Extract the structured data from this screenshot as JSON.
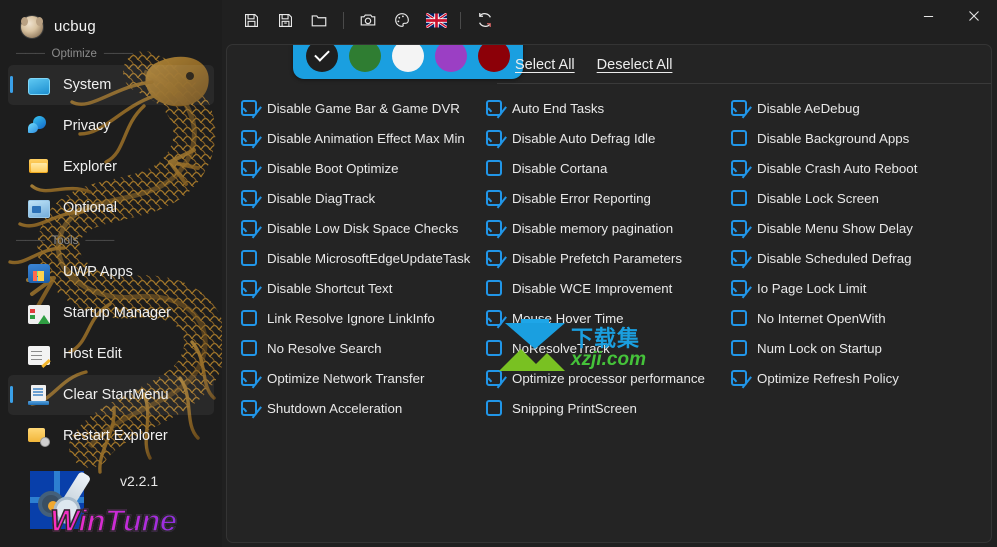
{
  "window": {
    "brand_name": "ucbug",
    "avatar_icon": "dog-avatar-icon",
    "minimize_label": "–",
    "close_label": "✕"
  },
  "toolbar": {
    "buttons": [
      {
        "name": "save-icon",
        "label": "Save"
      },
      {
        "name": "save-as-icon",
        "label": "Save As"
      },
      {
        "name": "open-folder-icon",
        "label": "Open"
      },
      {
        "name": "camera-icon",
        "label": "Screenshot"
      },
      {
        "name": "palette-icon",
        "label": "Theme"
      },
      {
        "name": "uk-flag-icon",
        "label": "Language"
      },
      {
        "name": "refresh-icon",
        "label": "Refresh"
      }
    ]
  },
  "color_picker": {
    "swatches": [
      {
        "name": "swatch-dark",
        "color": "#1f1f1f",
        "selected": true
      },
      {
        "name": "swatch-green",
        "color": "#2f7d32",
        "selected": false
      },
      {
        "name": "swatch-white",
        "color": "#f4f4f4",
        "selected": false
      },
      {
        "name": "swatch-purple",
        "color": "#9b3fc4",
        "selected": false
      },
      {
        "name": "swatch-darkred",
        "color": "#8c0008",
        "selected": false
      }
    ],
    "bar_color": "#1a9fe0"
  },
  "actions": {
    "select_all": "Select All",
    "deselect_all": "Deselect All"
  },
  "sidebar": {
    "sections": [
      {
        "title": "Optimize"
      },
      {
        "title": "Tools"
      }
    ],
    "items": [
      {
        "label": "System",
        "icon": "monitor-icon",
        "active": true,
        "section": 0
      },
      {
        "label": "Privacy",
        "icon": "privacy-shield-icon",
        "active": false,
        "section": 0
      },
      {
        "label": "Explorer",
        "icon": "folder-icon",
        "active": false,
        "section": 0
      },
      {
        "label": "Optional",
        "icon": "options-icon",
        "active": false,
        "section": 0
      },
      {
        "label": "UWP Apps",
        "icon": "store-bag-icon",
        "active": false,
        "section": 1
      },
      {
        "label": "Startup Manager",
        "icon": "startup-list-icon",
        "active": false,
        "section": 1
      },
      {
        "label": "Host Edit",
        "icon": "file-edit-icon",
        "active": false,
        "section": 1
      },
      {
        "label": "Clear StartMenu",
        "icon": "startmenu-icon",
        "active": true,
        "section": 1
      },
      {
        "label": "Restart Explorer",
        "icon": "folder-restart-icon",
        "active": false,
        "section": 1
      }
    ],
    "footer": {
      "version": "v2.2.1",
      "product": "WinTune",
      "logo_icon": "wintune-logo-icon"
    }
  },
  "options": {
    "columns": [
      [
        {
          "label": "Disable Game Bar & Game DVR",
          "checked": true
        },
        {
          "label": "Disable Animation Effect Max Min",
          "checked": true
        },
        {
          "label": "Disable Boot Optimize",
          "checked": true
        },
        {
          "label": "Disable DiagTrack",
          "checked": true
        },
        {
          "label": "Disable Low Disk Space Checks",
          "checked": true
        },
        {
          "label": "Disable MicrosoftEdgeUpdateTask",
          "checked": false
        },
        {
          "label": "Disable Shortcut Text",
          "checked": true
        },
        {
          "label": "Link Resolve Ignore LinkInfo",
          "checked": false
        },
        {
          "label": "No Resolve Search",
          "checked": false
        },
        {
          "label": "Optimize Network Transfer",
          "checked": true
        },
        {
          "label": "Shutdown Acceleration",
          "checked": true
        }
      ],
      [
        {
          "label": "Auto End Tasks",
          "checked": true
        },
        {
          "label": "Disable Auto Defrag Idle",
          "checked": true
        },
        {
          "label": "Disable Cortana",
          "checked": false
        },
        {
          "label": "Disable Error Reporting",
          "checked": true
        },
        {
          "label": "Disable memory pagination",
          "checked": true
        },
        {
          "label": "Disable Prefetch Parameters",
          "checked": true
        },
        {
          "label": "Disable WCE Improvement",
          "checked": false
        },
        {
          "label": "Mouse Hover Time",
          "checked": true
        },
        {
          "label": "NoResolveTrack",
          "checked": false
        },
        {
          "label": "Optimize processor performance",
          "checked": true
        },
        {
          "label": "Snipping PrintScreen",
          "checked": false
        }
      ],
      [
        {
          "label": "Disable AeDebug",
          "checked": true
        },
        {
          "label": "Disable Background Apps",
          "checked": false
        },
        {
          "label": "Disable Crash Auto Reboot",
          "checked": true
        },
        {
          "label": "Disable Lock Screen",
          "checked": false
        },
        {
          "label": "Disable Menu Show Delay",
          "checked": true
        },
        {
          "label": "Disable Scheduled Defrag",
          "checked": true
        },
        {
          "label": "Io Page Lock Limit",
          "checked": true
        },
        {
          "label": "No Internet OpenWith",
          "checked": false
        },
        {
          "label": "Num Lock on Startup",
          "checked": false
        },
        {
          "label": "Optimize Refresh Policy",
          "checked": true
        }
      ]
    ]
  },
  "watermark": {
    "primary": "下载集",
    "secondary": "xzji.com"
  }
}
